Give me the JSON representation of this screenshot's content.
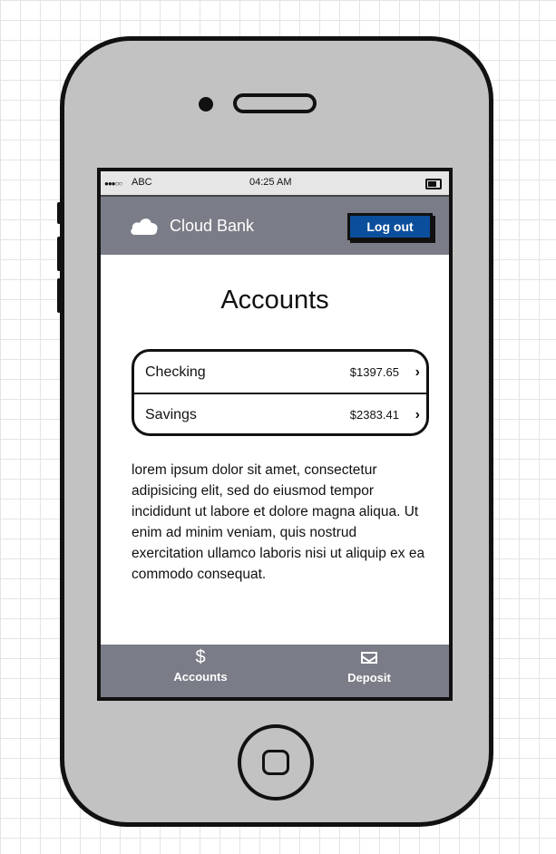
{
  "status_bar": {
    "carrier": "ABC",
    "time": "04:25 AM"
  },
  "header": {
    "brand": "Cloud Bank",
    "logout_label": "Log out"
  },
  "main": {
    "title": "Accounts",
    "accounts": [
      {
        "name": "Checking",
        "balance": "$1397.65"
      },
      {
        "name": "Savings",
        "balance": "$2383.41"
      }
    ],
    "body_text": "lorem ipsum dolor sit amet, consectetur adipisicing elit, sed do eiusmod tempor incididunt ut labore et dolore magna aliqua. Ut enim ad minim veniam, quis nostrud exercitation ullamco laboris nisi ut aliquip ex ea commodo consequat."
  },
  "tabbar": {
    "items": [
      {
        "label": "Accounts",
        "icon": "dollar-icon"
      },
      {
        "label": "Deposit",
        "icon": "envelope-icon"
      }
    ]
  },
  "icons": {
    "brand": "cloud-icon",
    "chevron": "chevron-right-icon"
  },
  "colors": {
    "header": "#7a7d87",
    "button": "#0b4f9c"
  }
}
